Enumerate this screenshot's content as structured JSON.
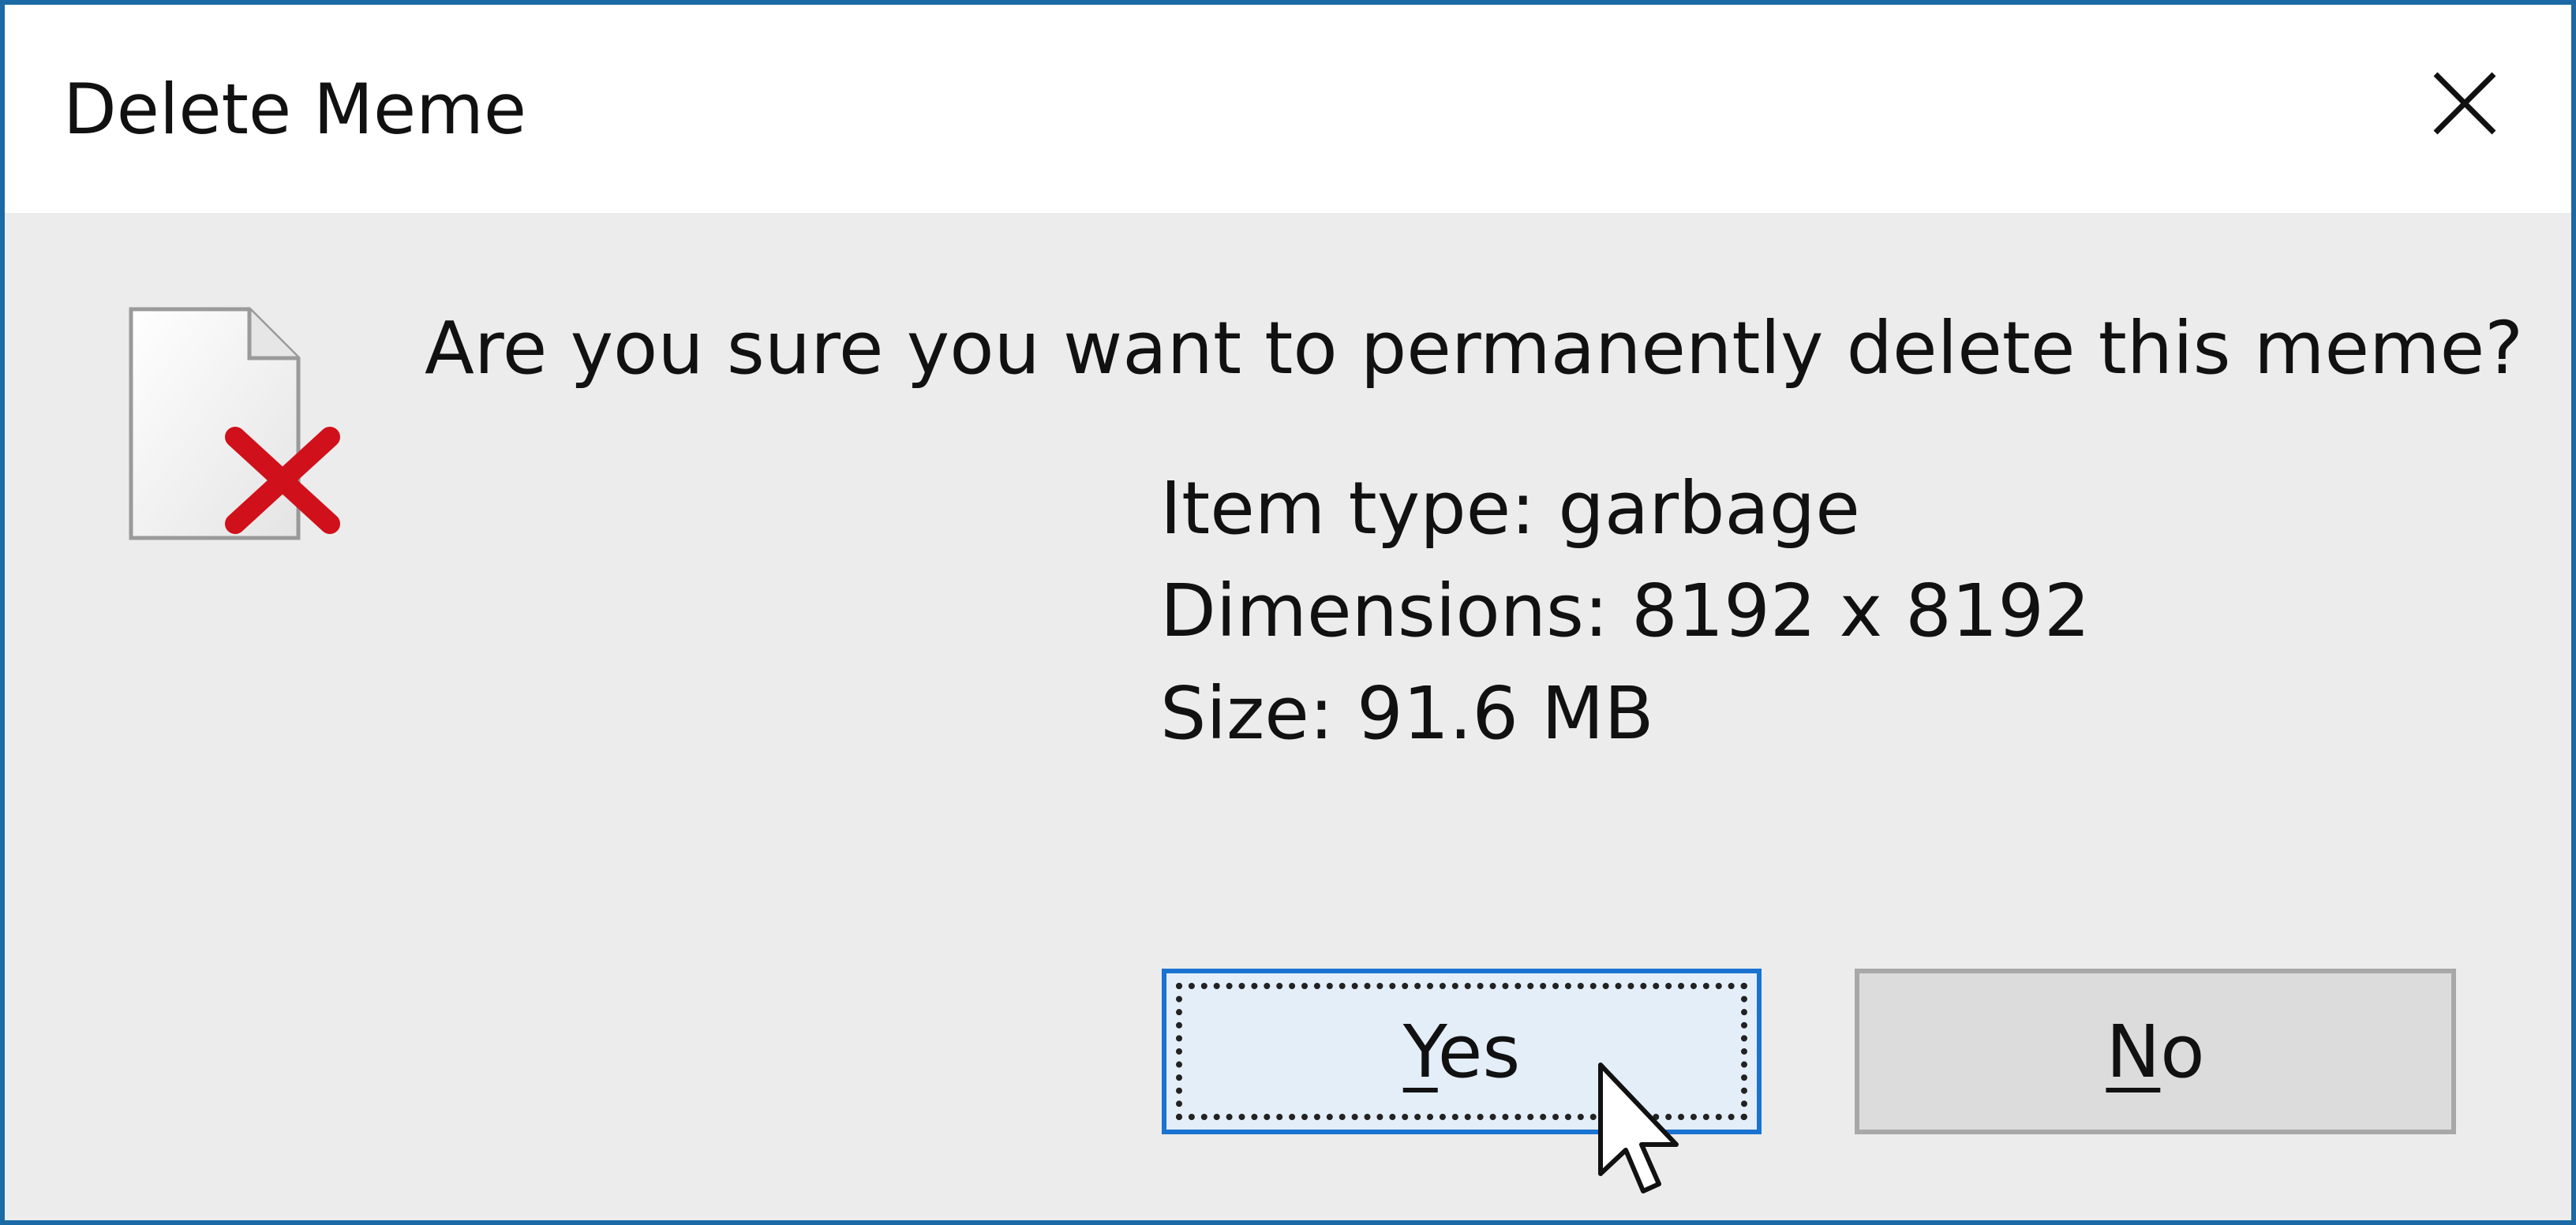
{
  "dialog": {
    "title": "Delete Meme",
    "message": "Are you sure you want to permanently delete this meme?",
    "details": [
      "Item type: garbage",
      "Dimensions: 8192 x 8192",
      "Size: 91.6 MB"
    ],
    "buttons": {
      "yes": {
        "accesskey": "Y",
        "rest": "es"
      },
      "no": {
        "accesskey": "N",
        "rest": "o"
      }
    }
  },
  "icons": {
    "close": "close-icon",
    "file": "document-delete-icon",
    "cursor": "mouse-pointer-icon"
  },
  "colors": {
    "window_border": "#1b6aa5",
    "dialog_bg": "#ececec",
    "delete_mark": "#d0101a",
    "yes_button_bg": "#e3eef8",
    "yes_button_border": "#1b73d1"
  }
}
